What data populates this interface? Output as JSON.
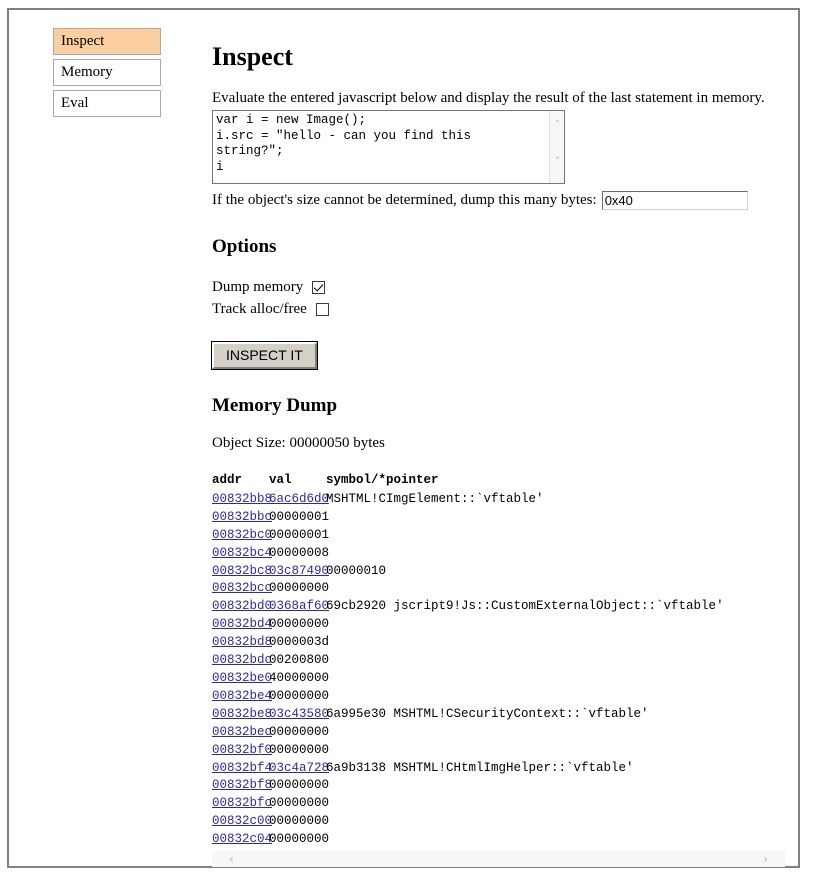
{
  "sidebar": {
    "tabs": [
      {
        "label": "Inspect",
        "active": true
      },
      {
        "label": "Memory",
        "active": false
      },
      {
        "label": "Eval",
        "active": false
      }
    ]
  },
  "main": {
    "title": "Inspect",
    "description": "Evaluate the entered javascript below and display the result of the last statement in memory.",
    "script_textarea": {
      "value": "var i = new Image();\ni.src = \"hello - can you find this string?\";\ni",
      "placeholder": ""
    },
    "bytes": {
      "label": "If the object's size cannot be determined, dump this many bytes:",
      "value": "0x40",
      "placeholder": ""
    },
    "options_heading": "Options",
    "options": [
      {
        "label": "Dump memory",
        "checked": true
      },
      {
        "label": "Track alloc/free",
        "checked": false
      }
    ],
    "submit_label": "INSPECT IT",
    "dump_heading": "Memory Dump",
    "object_size": "Object Size: 00000050 bytes",
    "table": {
      "headers": [
        "addr",
        "val",
        "symbol/*pointer"
      ],
      "rows": [
        {
          "addr": "00832bb8",
          "val": "6ac6d6d0",
          "val_link": true,
          "sym": "MSHTML!CImgElement::`vftable'"
        },
        {
          "addr": "00832bbc",
          "val": "00000001",
          "val_link": false,
          "sym": ""
        },
        {
          "addr": "00832bc0",
          "val": "00000001",
          "val_link": false,
          "sym": ""
        },
        {
          "addr": "00832bc4",
          "val": "00000008",
          "val_link": false,
          "sym": ""
        },
        {
          "addr": "00832bc8",
          "val": "03c87490",
          "val_link": true,
          "sym": "00000010"
        },
        {
          "addr": "00832bcc",
          "val": "00000000",
          "val_link": false,
          "sym": ""
        },
        {
          "addr": "00832bd0",
          "val": "0368af60",
          "val_link": true,
          "sym": "69cb2920 jscript9!Js::CustomExternalObject::`vftable'"
        },
        {
          "addr": "00832bd4",
          "val": "00000000",
          "val_link": false,
          "sym": ""
        },
        {
          "addr": "00832bd8",
          "val": "0000003d",
          "val_link": false,
          "sym": ""
        },
        {
          "addr": "00832bdc",
          "val": "00200800",
          "val_link": false,
          "sym": ""
        },
        {
          "addr": "00832be0",
          "val": "40000000",
          "val_link": false,
          "sym": ""
        },
        {
          "addr": "00832be4",
          "val": "00000000",
          "val_link": false,
          "sym": ""
        },
        {
          "addr": "00832be8",
          "val": "03c43580",
          "val_link": true,
          "sym": "6a995e30 MSHTML!CSecurityContext::`vftable'"
        },
        {
          "addr": "00832bec",
          "val": "00000000",
          "val_link": false,
          "sym": ""
        },
        {
          "addr": "00832bf0",
          "val": "00000000",
          "val_link": false,
          "sym": ""
        },
        {
          "addr": "00832bf4",
          "val": "03c4a728",
          "val_link": true,
          "sym": "6a9b3138 MSHTML!CHtmlImgHelper::`vftable'"
        },
        {
          "addr": "00832bf8",
          "val": "00000000",
          "val_link": false,
          "sym": ""
        },
        {
          "addr": "00832bfc",
          "val": "00000000",
          "val_link": false,
          "sym": ""
        },
        {
          "addr": "00832c00",
          "val": "00000000",
          "val_link": false,
          "sym": ""
        },
        {
          "addr": "00832c04",
          "val": "00000000",
          "val_link": false,
          "sym": ""
        }
      ]
    }
  },
  "scrollbars": {
    "horizontal": {
      "left_arrow": "‹",
      "right_arrow": "›"
    },
    "textarea_vertical": {
      "up_arrow": "˄",
      "down_arrow": "˅"
    }
  }
}
